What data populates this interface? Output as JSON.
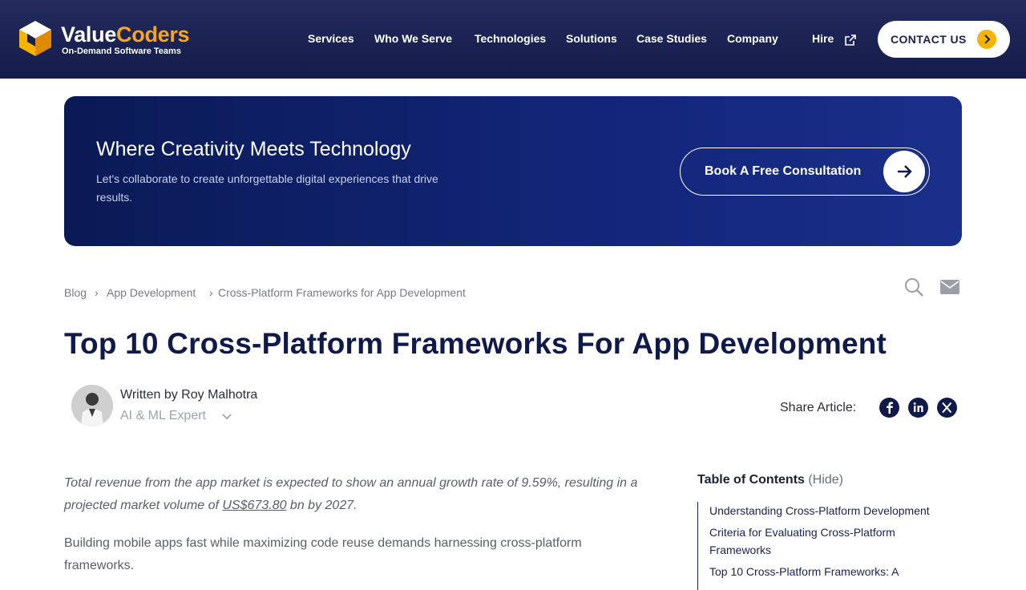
{
  "header": {
    "logo_value": "Value",
    "logo_coders": "Coders",
    "logo_tagline": "On-Demand Software Teams",
    "nav": [
      "Services",
      "Who We Serve",
      "Technologies",
      "Solutions",
      "Case Studies",
      "Company",
      "Hire"
    ],
    "contact_label": "CONTACT US"
  },
  "banner": {
    "title": "Where Creativity Meets Technology",
    "subtitle": "Let's collaborate to create unforgettable digital experiences that drive results.",
    "cta_label": "Book A Free Consultation"
  },
  "breadcrumb": [
    "Blog",
    "App Development",
    "Cross-Platform Frameworks for App Development"
  ],
  "breadcrumb_separator": "›",
  "article": {
    "title": "Top 10 Cross-Platform Frameworks For App Development",
    "author_line": "Written by Roy Malhotra",
    "author_role": "AI & ML Expert",
    "share_label": "Share Article:",
    "intro_part1": "Total revenue from the app market is expected to show an annual growth rate of 9.59%, resulting in a projected market volume of ",
    "intro_link": "US$673.80",
    "intro_part2": " bn by 2027.",
    "paragraph": "Building mobile apps fast while maximizing code reuse demands harnessing cross-platform frameworks."
  },
  "toc": {
    "title": "Table of Contents",
    "hide_label": "(Hide)",
    "items": [
      "Understanding Cross-Platform Development",
      "Criteria for Evaluating Cross-Platform Frameworks",
      "Top 10 Cross-Platform Frameworks: A"
    ]
  },
  "icons": {
    "search": "search-icon",
    "mail": "mail-icon",
    "facebook": "facebook-icon",
    "linkedin": "linkedin-icon",
    "x": "x-icon",
    "external": "external-link-icon"
  },
  "colors": {
    "header_bg": "#1a2151",
    "accent": "#f5a623",
    "title": "#101a4a",
    "banner_bg": "#0f1f6b"
  }
}
